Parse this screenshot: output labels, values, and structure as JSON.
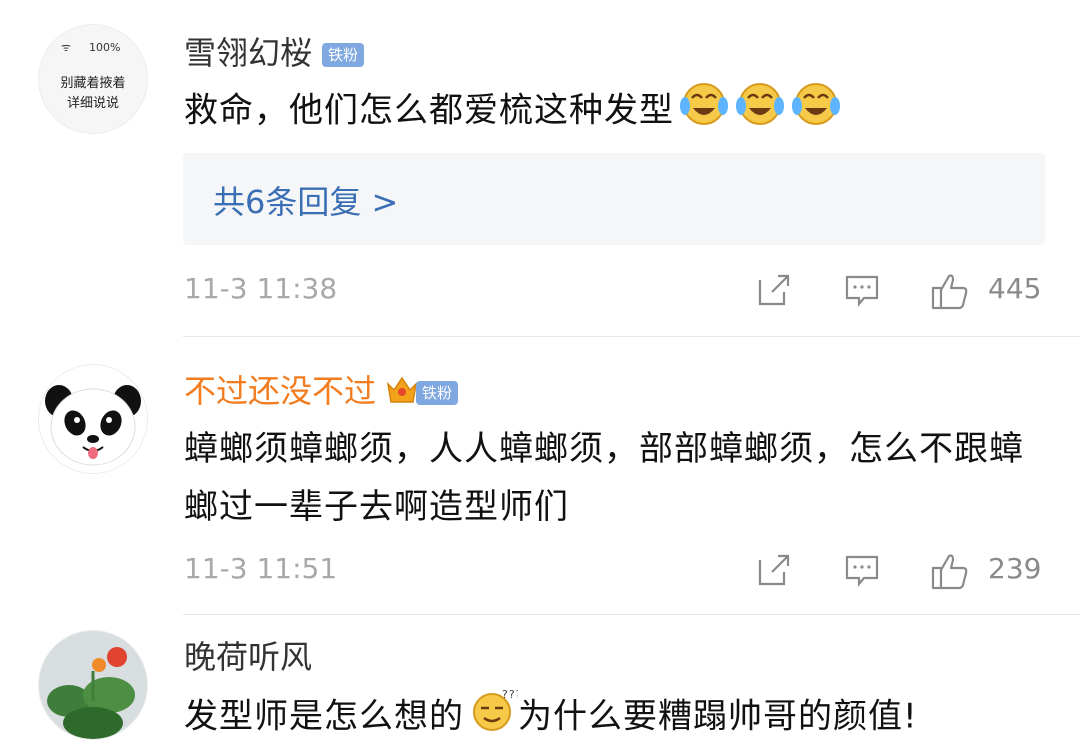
{
  "comments": [
    {
      "username": "雪翎幻桜",
      "badge": "铁粉",
      "avatar_text": {
        "status": "100%",
        "line1": "别藏着掖着",
        "line2": "详细说说"
      },
      "text": "救命，他们怎么都爱梳这种发型",
      "emojis": [
        "laughing-crying-emoji",
        "laughing-crying-emoji",
        "laughing-crying-emoji"
      ],
      "replies_label": "共6条回复 >",
      "time": "11-3 11:38",
      "likes": "445"
    },
    {
      "username": "不过还没不过",
      "badge": "铁粉",
      "username_color": "#f27c1e",
      "text": "蟑螂须蟑螂须，人人蟑螂须，部部蟑螂须，怎么不跟蟑螂过一辈子去啊造型师们",
      "time": "11-3 11:51",
      "likes": "239"
    },
    {
      "username": "晚荷听风",
      "text_before_emoji": "发型师是怎么想的",
      "emoji": "confused-emoji",
      "text_after_emoji": "为什么要糟蹋帅哥的颜值!"
    }
  ],
  "colors": {
    "reply_link": "#3a6fb5",
    "badge_bg": "#7fa7e0",
    "meta_gray": "#a8a8a8"
  }
}
